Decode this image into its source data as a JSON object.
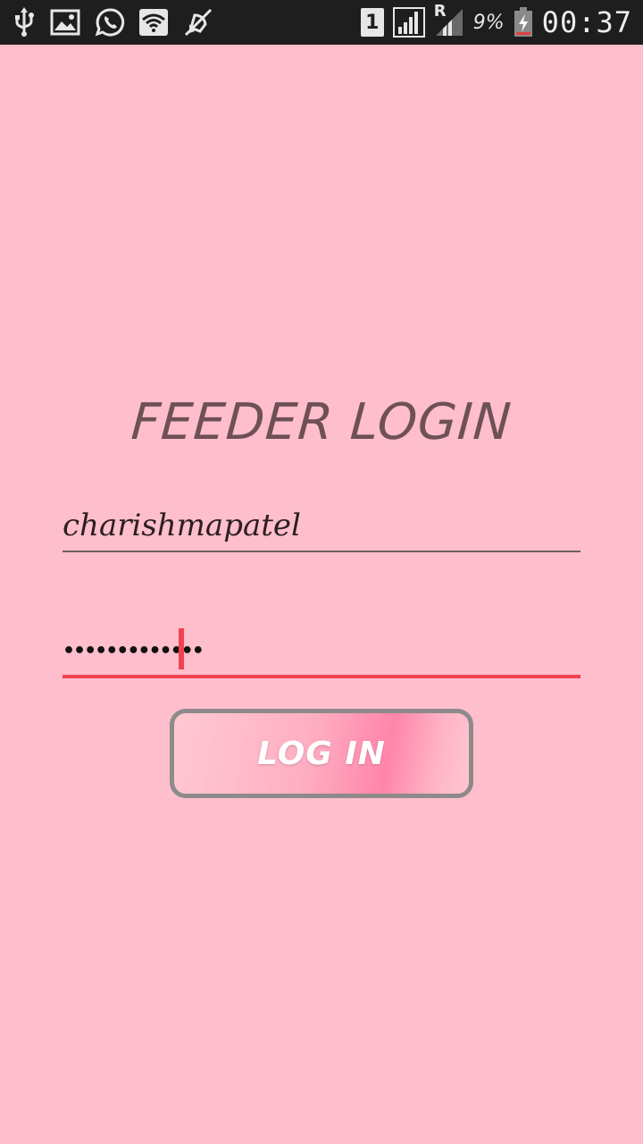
{
  "status_bar": {
    "icons_left": [
      "usb-icon",
      "image-icon",
      "whatsapp-icon",
      "wifi-icon",
      "mute-icon"
    ],
    "sim_slot": "1",
    "roaming": "R",
    "battery_percent": "9%",
    "time": "00:37"
  },
  "login": {
    "title": "FEEDER LOGIN",
    "username_value": "charishmapatel",
    "password_value": "•••••••••••••",
    "button_label": "LOG IN"
  },
  "colors": {
    "background": "#FFBECB",
    "status_bar": "#1E1E1E",
    "title": "#6E5057",
    "focus_accent": "#F4414F",
    "button_border": "#8E8A8B"
  }
}
